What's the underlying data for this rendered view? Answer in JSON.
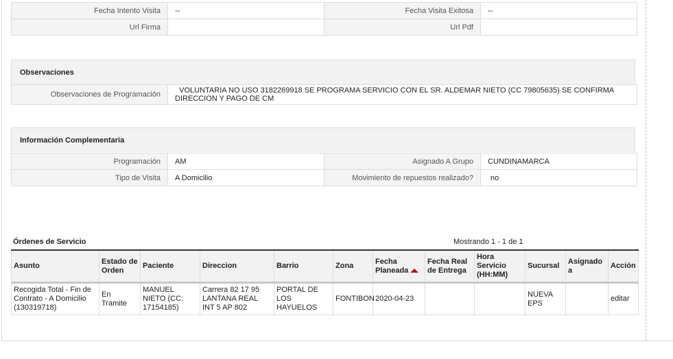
{
  "details": {
    "rows": [
      {
        "l1": "Fecha Intento Visita",
        "v1": "--",
        "l2": "Fecha Visita Exitosa",
        "v2": "--"
      },
      {
        "l1": "Url Firma",
        "v1": "",
        "l2": "Url Pdf",
        "v2": ""
      }
    ]
  },
  "observaciones": {
    "title": "Observaciones",
    "label": "Observaciones de Programación",
    "value": "VOLUNTARIA NO USO 3182269918 SE PROGRAMA SERVICIO CON EL SR. ALDEMAR NIETO (CC 79805635) SE CONFIRMA DIRECCION Y PAGO DE CM"
  },
  "complementaria": {
    "title": "Información Complementaria",
    "rows": [
      {
        "l1": "Programación",
        "v1": "AM",
        "l2": "Asignado A Grupo",
        "v2": "CUNDINAMARCA"
      },
      {
        "l1": "Tipo de Visita",
        "v1": "A Domicilio",
        "l2": "Movimiento de repuestos realizado?",
        "v2": "no"
      }
    ]
  },
  "ordenes": {
    "title": "Órdenes de Servicio",
    "showing": "Mostrando 1 - 1 de 1",
    "headers": [
      "Asunto",
      "Estado de Orden",
      "Paciente",
      "Direccion",
      "Barrio",
      "Zona",
      "Fecha Planeada",
      "Fecha Real de Entrega",
      "Hora Servicio (HH:MM)",
      "Sucursal",
      "Asignado a",
      "Acción"
    ],
    "rows": [
      {
        "asunto": "Recogida Total - Fin de Contrato - A Domicilio (130319718)",
        "estado": "En Tramite",
        "paciente": "MANUEL NIETO (CC: 17154185)",
        "direccion": "Carrera 82 17 95 LANTANA REAL INT 5 AP 802",
        "barrio": "PORTAL DE LOS HAYUELOS",
        "zona": "FONTIBON",
        "fecha_planeada": "2020-04-23",
        "fecha_real": "",
        "hora": "",
        "sucursal": "NUEVA EPS",
        "asignado": "",
        "accion": "editar"
      }
    ]
  },
  "colors": {
    "sort_arrow": "#b5121b",
    "header_bg": "#f2f2f2",
    "label_bg": "#f4f4f4",
    "border": "#dcdcdc"
  }
}
